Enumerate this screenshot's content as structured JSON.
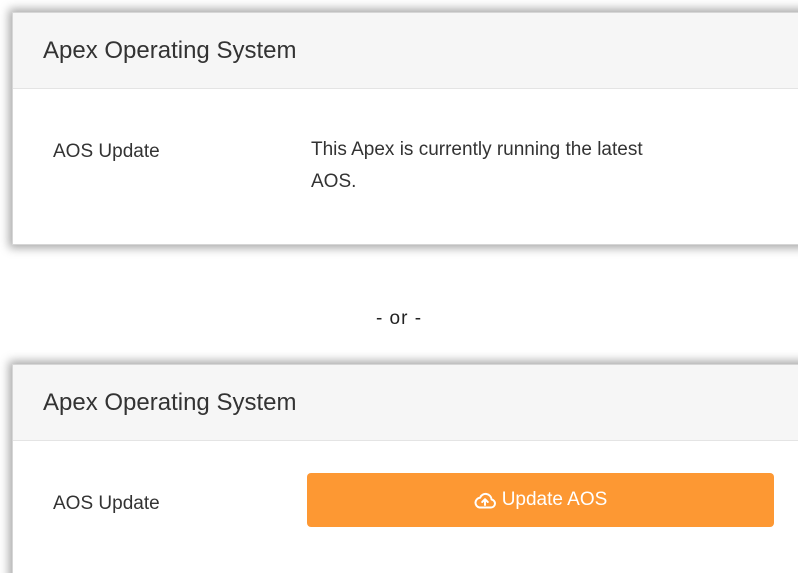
{
  "panel_top": {
    "title": "Apex Operating System",
    "row_label": "AOS Update",
    "status_line1": "This Apex is currently running the latest",
    "status_line2": "AOS."
  },
  "separator": "- or -",
  "panel_bottom": {
    "title": "Apex Operating System",
    "row_label": "AOS Update",
    "button_label": "Update AOS",
    "button_icon": "cloud-upload-icon"
  },
  "colors": {
    "button_bg": "#fd9833",
    "header_bg": "#f6f6f6"
  }
}
